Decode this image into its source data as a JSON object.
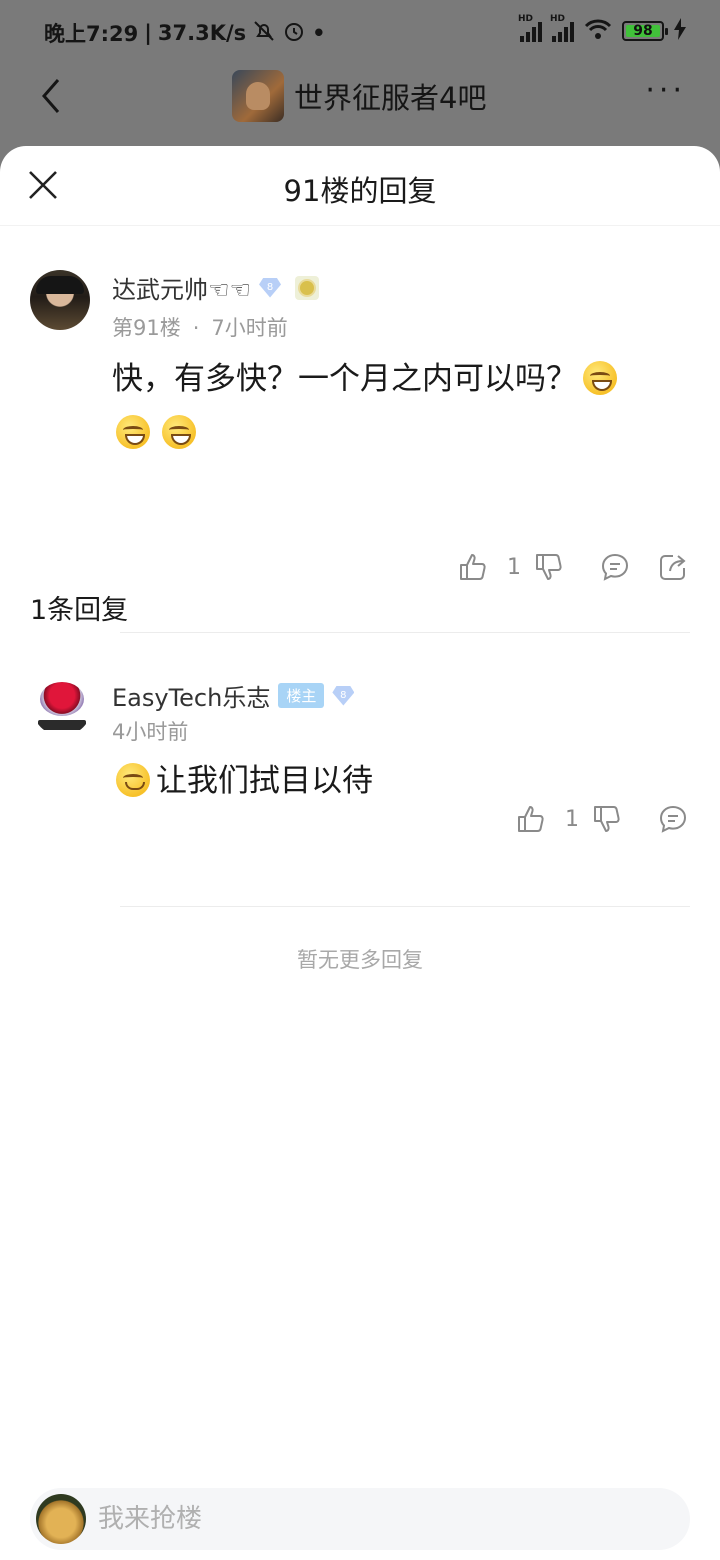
{
  "status_bar": {
    "time": "晚上7:29",
    "network_speed": "37.3K/s",
    "signal_labels": [
      "HD",
      "HD"
    ],
    "battery": "98",
    "icons": [
      "mute-bell-icon",
      "alarm-icon",
      "signal-icon",
      "wifi-icon",
      "battery-icon",
      "charging-icon"
    ]
  },
  "background_header": {
    "title": "世界征服者4吧",
    "back_icon": "chevron-left-icon",
    "more_icon": "more-dots-icon"
  },
  "sheet": {
    "title": "91楼的回复",
    "close_icon": "close-icon"
  },
  "post": {
    "username": "达武元帅☜☜",
    "level": "8",
    "floor": "第91楼",
    "separator": "·",
    "time": "7小时前",
    "text": "快，有多快？一个月之内可以吗？",
    "likes": "1"
  },
  "reply_count_label": "1条回复",
  "replies": [
    {
      "username": "EasyTech乐志",
      "badge": "楼主",
      "level": "8",
      "time": "4小时前",
      "text": "让我们拭目以待",
      "likes": "1"
    }
  ],
  "no_more_text": "暂无更多回复",
  "input": {
    "placeholder": "我来抢楼"
  },
  "colors": {
    "dim_overlay": "#7a7a7a",
    "sheet_bg": "#ffffff",
    "owner_tag": "#a8d4f6",
    "muted_text": "#9a9a9a",
    "battery_fill": "#41c13a"
  }
}
